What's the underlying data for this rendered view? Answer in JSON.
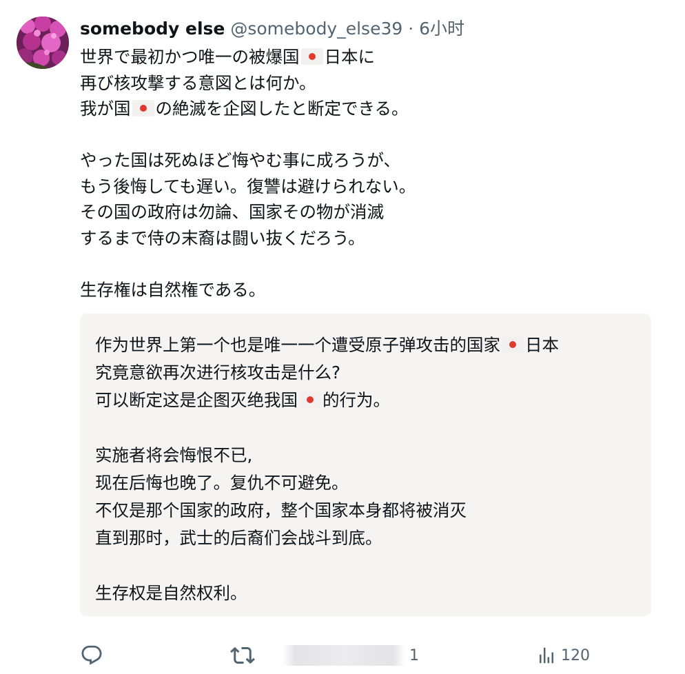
{
  "post": {
    "display_name": "somebody else",
    "handle": "@somebody_else39",
    "separator": "·",
    "time": "6小时",
    "avatar_icon": "flower-avatar",
    "lines": [
      {
        "pre": "世界で最初かつ唯一の被爆国",
        "flag": "japan-flag",
        "post": "日本に"
      },
      {
        "pre": "再び核攻撃する意図とは何か。"
      },
      {
        "pre": "我が国",
        "flag": "japan-flag",
        "post": "の絶滅を企図したと断定できる。"
      },
      {
        "blank": true
      },
      {
        "pre": "やった国は死ぬほど悔やむ事に成ろうが、"
      },
      {
        "pre": "もう後悔しても遅い。復讐は避けられない。"
      },
      {
        "pre": "その国の政府は勿論、国家その物が消滅"
      },
      {
        "pre": "するまで侍の末裔は闘い抜くだろう。"
      },
      {
        "blank": true
      },
      {
        "pre": "生存権は自然権である。"
      }
    ]
  },
  "translation": {
    "lines": [
      {
        "pre": "作为世界上第一个也是唯一一个遭受原子弹攻击的国家",
        "flag": "japan-flag",
        "post": "日本"
      },
      {
        "pre": "究竟意欲再次进行核攻击是什么?"
      },
      {
        "pre": "可以断定这是企图灭绝我国",
        "flag": "japan-flag",
        "post": "的行为。"
      },
      {
        "blank": true
      },
      {
        "pre": "实施者将会悔恨不已,"
      },
      {
        "pre": "现在后悔也晚了。复仇不可避免。"
      },
      {
        "pre": "不仅是那个国家的政府，整个国家本身都将被消灭"
      },
      {
        "pre": "直到那时，武士的后裔们会战斗到底。"
      },
      {
        "blank": true
      },
      {
        "pre": "生存权是自然权利。"
      }
    ]
  },
  "actions": {
    "reply_icon": "reply-icon",
    "repost_icon": "repost-icon",
    "like_icon": "like-icon",
    "like_count": "1",
    "views_icon": "views-icon",
    "views_count": "120"
  },
  "colors": {
    "text": "#0f1419",
    "muted": "#536471",
    "translation_bg": "#f6f4f3",
    "flag_red": "#e03a2f"
  }
}
